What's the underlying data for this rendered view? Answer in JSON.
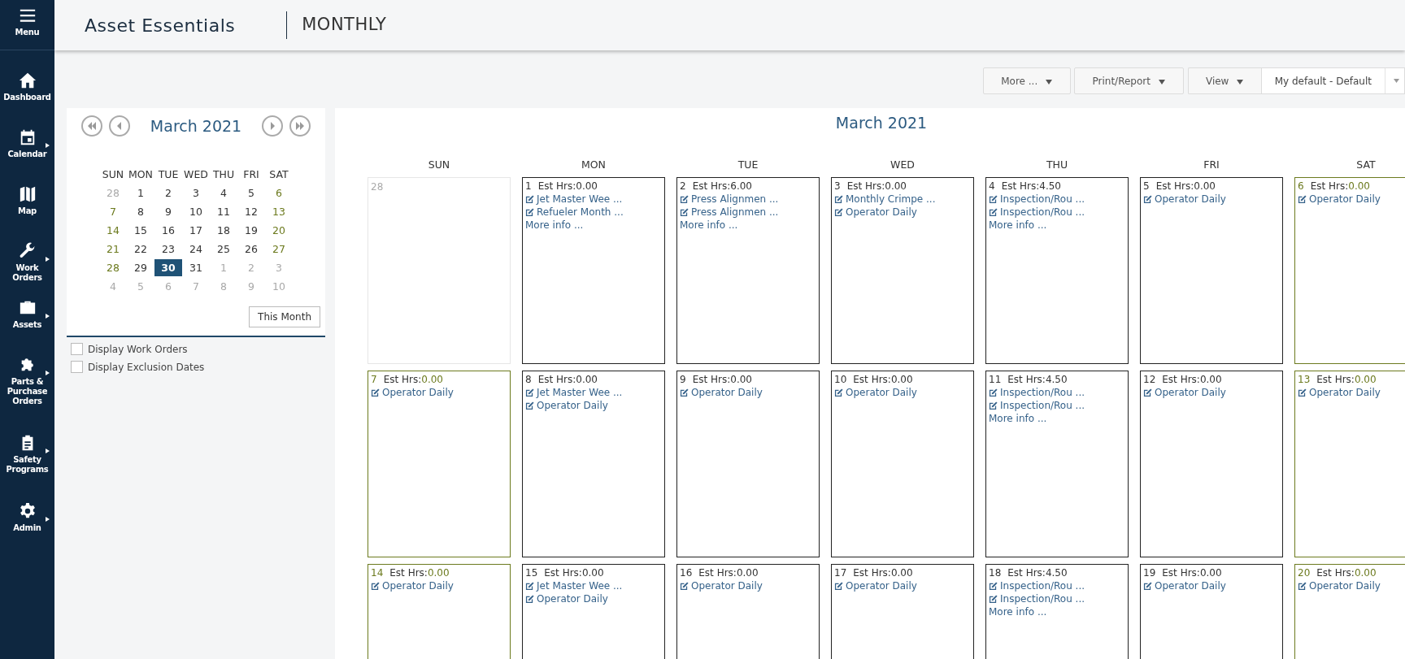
{
  "sidebar": {
    "items": [
      {
        "label": "Menu",
        "submenu": false
      },
      {
        "label": "Dashboard",
        "submenu": false
      },
      {
        "label": "Calendar",
        "submenu": true
      },
      {
        "label": "Map",
        "submenu": false
      },
      {
        "label": "Work Orders",
        "submenu": true
      },
      {
        "label": "Assets",
        "submenu": true
      },
      {
        "label": "Parts & Purchase Orders",
        "submenu": true
      },
      {
        "label": "Safety Programs",
        "submenu": true
      },
      {
        "label": "Admin",
        "submenu": true
      }
    ]
  },
  "header": {
    "app_title": "Asset Essentials",
    "view_title": "MONTHLY"
  },
  "toolbar": {
    "buttons": [
      {
        "label": "More ..."
      },
      {
        "label": "Print/Report"
      },
      {
        "label": "View"
      }
    ],
    "layout_select": {
      "value": "My default - Default"
    }
  },
  "mini_calendar": {
    "title": "March 2021",
    "weekdays": [
      "SUN",
      "MON",
      "TUE",
      "WED",
      "THU",
      "FRI",
      "SAT"
    ],
    "weeks": [
      [
        {
          "day": "28",
          "muted": true,
          "selected": false
        },
        {
          "day": "1",
          "muted": false,
          "weekend": false,
          "selected": false
        },
        {
          "day": "2",
          "muted": false,
          "weekend": false,
          "selected": false
        },
        {
          "day": "3",
          "muted": false,
          "weekend": false,
          "selected": false
        },
        {
          "day": "4",
          "muted": false,
          "weekend": false,
          "selected": false
        },
        {
          "day": "5",
          "muted": false,
          "weekend": false,
          "selected": false
        },
        {
          "day": "6",
          "muted": false,
          "weekend": true,
          "selected": false
        }
      ],
      [
        {
          "day": "7",
          "muted": false,
          "weekend": true,
          "selected": false
        },
        {
          "day": "8",
          "muted": false,
          "weekend": false,
          "selected": false
        },
        {
          "day": "9",
          "muted": false,
          "weekend": false,
          "selected": false
        },
        {
          "day": "10",
          "muted": false,
          "weekend": false,
          "selected": false
        },
        {
          "day": "11",
          "muted": false,
          "weekend": false,
          "selected": false
        },
        {
          "day": "12",
          "muted": false,
          "weekend": false,
          "selected": false
        },
        {
          "day": "13",
          "muted": false,
          "weekend": true,
          "selected": false
        }
      ],
      [
        {
          "day": "14",
          "muted": false,
          "weekend": true,
          "selected": false
        },
        {
          "day": "15",
          "muted": false,
          "weekend": false,
          "selected": false
        },
        {
          "day": "16",
          "muted": false,
          "weekend": false,
          "selected": false
        },
        {
          "day": "17",
          "muted": false,
          "weekend": false,
          "selected": false
        },
        {
          "day": "18",
          "muted": false,
          "weekend": false,
          "selected": false
        },
        {
          "day": "19",
          "muted": false,
          "weekend": false,
          "selected": false
        },
        {
          "day": "20",
          "muted": false,
          "weekend": true,
          "selected": false
        }
      ],
      [
        {
          "day": "21",
          "muted": false,
          "weekend": true,
          "selected": false
        },
        {
          "day": "22",
          "muted": false,
          "weekend": false,
          "selected": false
        },
        {
          "day": "23",
          "muted": false,
          "weekend": false,
          "selected": false
        },
        {
          "day": "24",
          "muted": false,
          "weekend": false,
          "selected": false
        },
        {
          "day": "25",
          "muted": false,
          "weekend": false,
          "selected": false
        },
        {
          "day": "26",
          "muted": false,
          "weekend": false,
          "selected": false
        },
        {
          "day": "27",
          "muted": false,
          "weekend": true,
          "selected": false
        }
      ],
      [
        {
          "day": "28",
          "muted": false,
          "weekend": true,
          "selected": false
        },
        {
          "day": "29",
          "muted": false,
          "weekend": false,
          "selected": false
        },
        {
          "day": "30",
          "muted": false,
          "weekend": false,
          "selected": true
        },
        {
          "day": "31",
          "muted": false,
          "weekend": false,
          "selected": false
        },
        {
          "day": "1",
          "muted": true,
          "selected": false
        },
        {
          "day": "2",
          "muted": true,
          "selected": false
        },
        {
          "day": "3",
          "muted": true,
          "selected": false
        }
      ],
      [
        {
          "day": "4",
          "muted": true,
          "selected": false
        },
        {
          "day": "5",
          "muted": true,
          "selected": false
        },
        {
          "day": "6",
          "muted": true,
          "selected": false
        },
        {
          "day": "7",
          "muted": true,
          "selected": false
        },
        {
          "day": "8",
          "muted": true,
          "selected": false
        },
        {
          "day": "9",
          "muted": true,
          "selected": false
        },
        {
          "day": "10",
          "muted": true,
          "selected": false
        }
      ]
    ],
    "this_month_button": "This Month"
  },
  "options": [
    {
      "label": "Display Work Orders",
      "checked": false
    },
    {
      "label": "Display Exclusion Dates",
      "checked": false
    }
  ],
  "month_view": {
    "title": "March 2021",
    "weekdays": [
      "SUN",
      "MON",
      "TUE",
      "WED",
      "THU",
      "FRI",
      "SAT"
    ],
    "weeks": [
      [
        {
          "kind": "outside",
          "day": "28"
        },
        {
          "kind": "day",
          "day": "1",
          "weekend": false,
          "est_label": "Est Hrs:",
          "est_value": "0.00",
          "items": [
            "Jet Master Wee ...",
            "Refueler Month ..."
          ],
          "more": "More info ..."
        },
        {
          "kind": "day",
          "day": "2",
          "weekend": false,
          "est_label": "Est Hrs:",
          "est_value": "6.00",
          "items": [
            "Press Alignmen ...",
            "Press Alignmen ..."
          ],
          "more": "More info ..."
        },
        {
          "kind": "day",
          "day": "3",
          "weekend": false,
          "est_label": "Est Hrs:",
          "est_value": "0.00",
          "items": [
            "Monthly Crimpe ...",
            "Operator Daily"
          ]
        },
        {
          "kind": "day",
          "day": "4",
          "weekend": false,
          "est_label": "Est Hrs:",
          "est_value": "4.50",
          "items": [
            "Inspection/Rou ...",
            "Inspection/Rou ..."
          ],
          "more": "More info ..."
        },
        {
          "kind": "day",
          "day": "5",
          "weekend": false,
          "est_label": "Est Hrs:",
          "est_value": "0.00",
          "items": [
            "Operator Daily"
          ]
        },
        {
          "kind": "day",
          "day": "6",
          "weekend": true,
          "est_label": "Est Hrs:",
          "est_value": "0.00",
          "items": [
            "Operator Daily"
          ]
        }
      ],
      [
        {
          "kind": "day",
          "day": "7",
          "weekend": true,
          "est_label": "Est Hrs:",
          "est_value": "0.00",
          "items": [
            "Operator Daily"
          ]
        },
        {
          "kind": "day",
          "day": "8",
          "weekend": false,
          "est_label": "Est Hrs:",
          "est_value": "0.00",
          "items": [
            "Jet Master Wee ...",
            "Operator Daily"
          ]
        },
        {
          "kind": "day",
          "day": "9",
          "weekend": false,
          "est_label": "Est Hrs:",
          "est_value": "0.00",
          "items": [
            "Operator Daily"
          ]
        },
        {
          "kind": "day",
          "day": "10",
          "weekend": false,
          "est_label": "Est Hrs:",
          "est_value": "0.00",
          "items": [
            "Operator Daily"
          ]
        },
        {
          "kind": "day",
          "day": "11",
          "weekend": false,
          "est_label": "Est Hrs:",
          "est_value": "4.50",
          "items": [
            "Inspection/Rou ...",
            "Inspection/Rou ..."
          ],
          "more": "More info ..."
        },
        {
          "kind": "day",
          "day": "12",
          "weekend": false,
          "est_label": "Est Hrs:",
          "est_value": "0.00",
          "items": [
            "Operator Daily"
          ]
        },
        {
          "kind": "day",
          "day": "13",
          "weekend": true,
          "est_label": "Est Hrs:",
          "est_value": "0.00",
          "items": [
            "Operator Daily"
          ]
        }
      ],
      [
        {
          "kind": "day",
          "day": "14",
          "weekend": true,
          "est_label": "Est Hrs:",
          "est_value": "0.00",
          "items": [
            "Operator Daily"
          ]
        },
        {
          "kind": "day",
          "day": "15",
          "weekend": false,
          "est_label": "Est Hrs:",
          "est_value": "0.00",
          "items": [
            "Jet Master Wee ...",
            "Operator Daily"
          ]
        },
        {
          "kind": "day",
          "day": "16",
          "weekend": false,
          "est_label": "Est Hrs:",
          "est_value": "0.00",
          "items": [
            "Operator Daily"
          ]
        },
        {
          "kind": "day",
          "day": "17",
          "weekend": false,
          "est_label": "Est Hrs:",
          "est_value": "0.00",
          "items": [
            "Operator Daily"
          ]
        },
        {
          "kind": "day",
          "day": "18",
          "weekend": false,
          "est_label": "Est Hrs:",
          "est_value": "4.50",
          "items": [
            "Inspection/Rou ...",
            "Inspection/Rou ..."
          ],
          "more": "More info ..."
        },
        {
          "kind": "day",
          "day": "19",
          "weekend": false,
          "est_label": "Est Hrs:",
          "est_value": "0.00",
          "items": [
            "Operator Daily"
          ]
        },
        {
          "kind": "day",
          "day": "20",
          "weekend": true,
          "est_label": "Est Hrs:",
          "est_value": "0.00",
          "items": [
            "Operator Daily"
          ]
        }
      ]
    ]
  }
}
